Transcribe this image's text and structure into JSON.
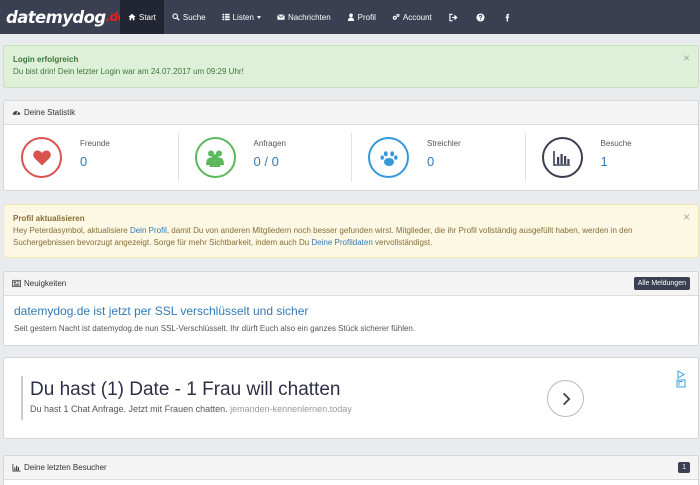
{
  "brand": {
    "part1": "date",
    "part2": "mydog",
    "part3": ".de"
  },
  "nav": {
    "start": "Start",
    "suche": "Suche",
    "listen": "Listen",
    "nachrichten": "Nachrichten",
    "profil": "Profil",
    "account": "Account"
  },
  "login_alert": {
    "title": "Login erfolgreich",
    "text": "Du bist drin! Dein letzter Login war am 24.07.2017 um 09:29 Uhr!",
    "close": "×"
  },
  "stats": {
    "heading": "Deine Statistik",
    "items": [
      {
        "label": "Freunde",
        "value": "0",
        "color": "#d9534f",
        "icon": "heart-icon"
      },
      {
        "label": "Anfragen",
        "value": "0 / 0",
        "color": "#5cb85c",
        "icon": "users-icon"
      },
      {
        "label": "Streichler",
        "value": "0",
        "color": "#3498db",
        "icon": "paw-icon"
      },
      {
        "label": "Besuche",
        "value": "1",
        "color": "#3a3f51",
        "icon": "bar-chart-icon"
      }
    ]
  },
  "profile_alert": {
    "title": "Profil aktualisieren",
    "text_1": "Hey Peterdasymbol, aktualisiere ",
    "link_1": "Dein Profil",
    "text_2": ", damit Du von anderen Mitgliedern noch besser gefunden wirst. Mitglieder, die ihr Profil vollständig ausgefüllt haben, werden in den Suchergebnissen bevorzugt angezeigt. Sorge für mehr Sichtbarkeit, indem auch Du ",
    "link_2": "Deine Profildaten",
    "text_3": " vervollständigst.",
    "close": "×"
  },
  "news": {
    "heading": "Neuigkeiten",
    "all_button": "Alle Meldungen",
    "title": "datemydog.de ist jetzt per SSL verschlüsselt und sicher",
    "text": "Seit gestern Nacht ist datemydog.de nun SSL-Verschlüsselt. Ihr dürft Euch also ein ganzes Stück sicherer fühlen."
  },
  "ad": {
    "title": "Du hast (1) Date - 1 Frau will chatten",
    "subtitle": "Du hast 1 Chat Anfrage. Jetzt mit Frauen chatten.",
    "url": "jemanden-kennenlernen.today"
  },
  "visitors": {
    "heading": "Deine letzten Besucher",
    "count": "1"
  }
}
